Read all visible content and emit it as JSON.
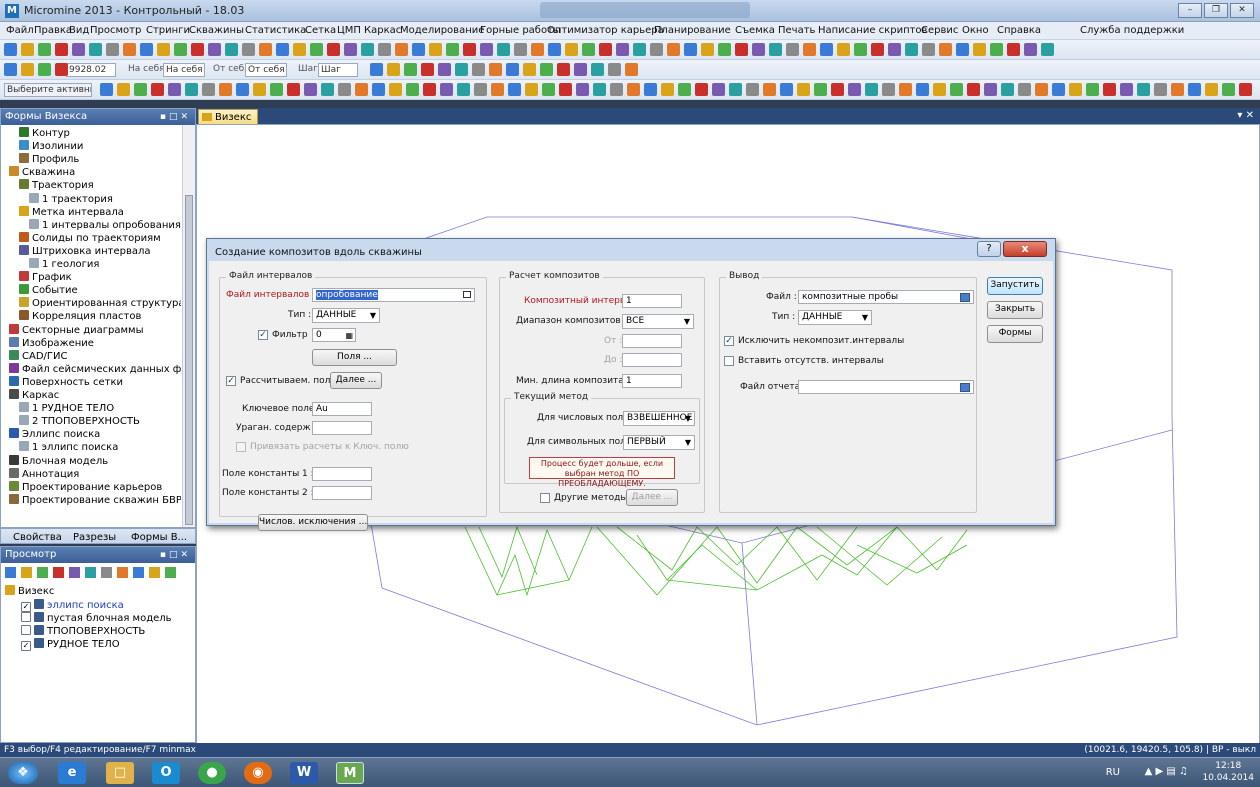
{
  "window": {
    "title": "Micromine 2013 - Контрольный - 18.03",
    "app_icon": "M"
  },
  "menu": [
    "Файл",
    "Правка",
    "Вид",
    "Просмотр",
    "Стринги",
    "Скважины",
    "Статистика",
    "Сетка",
    "ЦМП",
    "Каркас",
    "Моделирование",
    "Горные работы",
    "Оптимизатор карьера",
    "Планирование",
    "Съемка",
    "Печать",
    "Написание скриптов",
    "Сервис",
    "Окно",
    "Справка",
    "Служба поддержки"
  ],
  "toolbar2": {
    "coord_value": "9928.02",
    "na_sebya_1": "На себя",
    "na_sebya_2": "На себя",
    "ot_sebya_1": "От себя",
    "ot_sebya_2": "От себя",
    "shag_1": "Шаг",
    "shag_2": "Шаг"
  },
  "toolbar3": {
    "active_layer": "Выберите активный слой"
  },
  "forms_panel": {
    "title": "Формы Визекса",
    "items": [
      {
        "label": "Контур",
        "level": 1,
        "color": "#2b7a2b"
      },
      {
        "label": "Изолинии",
        "level": 1,
        "color": "#3a8ec9"
      },
      {
        "label": "Профиль",
        "level": 1,
        "color": "#8a6d3b"
      },
      {
        "label": "Скважина",
        "level": 0,
        "color": "#c98a2a"
      },
      {
        "label": "Траектория",
        "level": 1,
        "color": "#6b7a33"
      },
      {
        "label": "1 траектория",
        "level": 2,
        "color": "#9aa7b5"
      },
      {
        "label": "Метка интервала",
        "level": 1,
        "color": "#d9a31a"
      },
      {
        "label": "1 интервалы опробования",
        "level": 2,
        "color": "#9aa7b5"
      },
      {
        "label": "Солиды по траекториям",
        "level": 1,
        "color": "#c05a1a"
      },
      {
        "label": "Штриховка интервала",
        "level": 1,
        "color": "#5a5a9a"
      },
      {
        "label": "1 геология",
        "level": 2,
        "color": "#9aa7b5"
      },
      {
        "label": "График",
        "level": 1,
        "color": "#c03a3a"
      },
      {
        "label": "Событие",
        "level": 1,
        "color": "#3a9a3a"
      },
      {
        "label": "Ориентированная структура",
        "level": 1,
        "color": "#c9a32a"
      },
      {
        "label": "Корреляция пластов",
        "level": 1,
        "color": "#8a5a2a"
      },
      {
        "label": "Секторные диаграммы",
        "level": 0,
        "color": "#c03a3a"
      },
      {
        "label": "Изображение",
        "level": 0,
        "color": "#5a7ab0"
      },
      {
        "label": "CAD/ГИС",
        "level": 0,
        "color": "#3a8a5a"
      },
      {
        "label": "Файл сейсмических данных форм",
        "level": 0,
        "color": "#7a3a9a"
      },
      {
        "label": "Поверхность сетки",
        "level": 0,
        "color": "#2a6ab0"
      },
      {
        "label": "Каркас",
        "level": 0,
        "color": "#4a4a4a"
      },
      {
        "label": "1 РУДНОЕ ТЕЛО",
        "level": 1,
        "color": "#9aa7b5"
      },
      {
        "label": "2 ТПОПОВЕРХНОСТЬ",
        "level": 1,
        "color": "#9aa7b5"
      },
      {
        "label": "Эллипс поиска",
        "level": 0,
        "color": "#2a5ab0"
      },
      {
        "label": "1 эллипс поиска",
        "level": 1,
        "color": "#9aa7b5"
      },
      {
        "label": "Блочная модель",
        "level": 0,
        "color": "#3a3a3a"
      },
      {
        "label": "Аннотация",
        "level": 0,
        "color": "#6a6a6a"
      },
      {
        "label": "Проектирование карьеров",
        "level": 0,
        "color": "#6a8a3a"
      },
      {
        "label": "Проектирование скважин БВР",
        "level": 0,
        "color": "#8a6a3a"
      }
    ],
    "tabs": [
      "Свойства",
      "Разрезы",
      "Формы В..."
    ]
  },
  "view_panel": {
    "title": "Просмотр",
    "root": "Визекс",
    "items": [
      {
        "label": "эллипс поиска",
        "checked": true,
        "highlight": true
      },
      {
        "label": "пустая блочная модель",
        "checked": false,
        "highlight": false
      },
      {
        "label": "ТПОПОВЕРХНОСТЬ",
        "checked": false,
        "highlight": false
      },
      {
        "label": "РУДНОЕ ТЕЛО",
        "checked": true,
        "highlight": false
      }
    ]
  },
  "doc_tab": {
    "label": "Визекс"
  },
  "dialog": {
    "title": "Создание композитов вдоль скважины",
    "help": "?",
    "close": "x",
    "intervals": {
      "group": "Файл интервалов",
      "file_label": "Файл интервалов :",
      "file_value": "опробование",
      "type_label": "Тип :",
      "type_value": "ДАННЫЕ",
      "filter_label": "Фильтр",
      "filter_value": "0",
      "fields_btn": "Поля ...",
      "calc_fields_label": "Рассчитываем. поля",
      "more_btn": "Далее ...",
      "key_label": "Ключевое поле :",
      "key_value": "Au",
      "outlier_label": "Ураган. содерж :",
      "bind_label": "Привязать расчеты к Ключ. полю",
      "const1_label": "Поле константы 1 :",
      "const2_label": "Поле константы 2 :",
      "num_excl_btn": "Числов. исключения ..."
    },
    "calc": {
      "group": "Расчет композитов",
      "interval_label": "Композитный интервал :",
      "interval_value": "1",
      "range_label": "Диапазон композитов :",
      "range_value": "ВСЕ",
      "from_label": "От :",
      "to_label": "До :",
      "min_len_label": "Мин. длина композита :",
      "min_len_value": "1",
      "method_group": "Текущий метод",
      "num_fields_label": "Для числовых полей :",
      "num_fields_value": "ВЗВЕШЕННОЕ (",
      "sym_fields_label": "Для символьных полей :",
      "sym_fields_value": "ПЕРВЫЙ",
      "note": "Процесс будет дольше, если выбран метод ПО ПРЕОБЛАДАЮЩЕМУ.",
      "other_methods_label": "Другие методы",
      "more_btn": "Далее ..."
    },
    "output": {
      "group": "Вывод",
      "file_label": "Файл :",
      "file_value": "композитные пробы",
      "type_label": "Тип :",
      "type_value": "ДАННЫЕ",
      "exclude_label": "Исключить некомпозит.интервалы",
      "insert_label": "Вставить отсутств. интервалы",
      "report_label": "Файл отчета :"
    },
    "buttons": {
      "run": "Запустить",
      "close": "Закрыть",
      "forms": "Формы"
    }
  },
  "status": {
    "left": "F3 выбор/F4 редактирование/F7 minmax",
    "right": "(10021.6, 19420.5, 105.8) | ВР - выкл"
  },
  "taskbar": {
    "lang": "RU",
    "time": "12:18",
    "date": "10.04.2014"
  }
}
